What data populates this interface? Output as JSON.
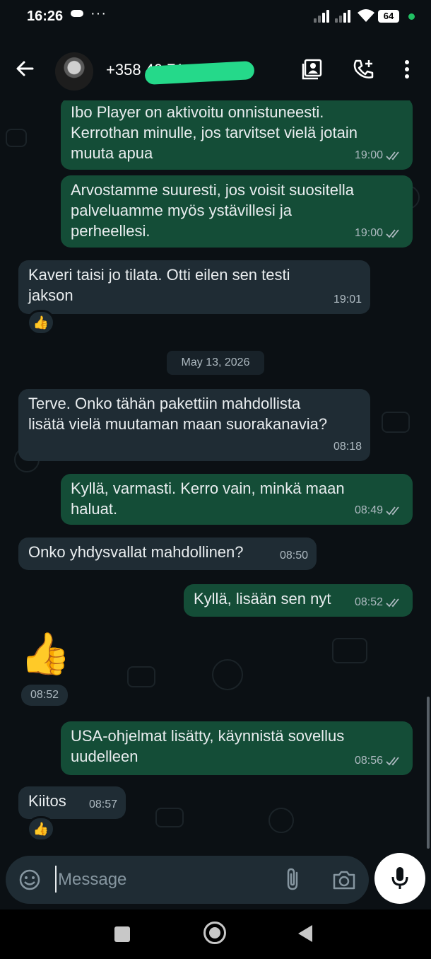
{
  "status_bar": {
    "time": "16:26",
    "more": "···",
    "battery": "64"
  },
  "header": {
    "contact_phone": "+358 40 71"
  },
  "messages": [
    {
      "dir": "out",
      "text": "Ibo Player on aktivoitu onnistuneesti.\nKerrothan minulle, jos tarvitset vielä jotain\nmuuta apua",
      "time": "19:00"
    },
    {
      "dir": "out",
      "text": "Arvostamme suuresti, jos voisit suositella\npalveluamme myös ystävillesi ja\nperheellesi.",
      "time": "19:00"
    },
    {
      "dir": "in",
      "text": "Kaveri taisi jo tilata. Otti eilen sen testi\njakson",
      "time": "19:01",
      "reaction": "👍"
    },
    {
      "dir": "in",
      "text": "Terve. Onko tähän pakettiin mahdollista\nlisätä vielä muutaman maan suorakanavia?",
      "time": "08:18"
    },
    {
      "dir": "out",
      "text": "Kyllä, varmasti. Kerro vain, minkä maan\nhaluat.",
      "time": "08:49"
    },
    {
      "dir": "in",
      "text": "Onko yhdysvallat mahdollinen?",
      "time": "08:50"
    },
    {
      "dir": "out",
      "text": "Kyllä, lisään sen nyt",
      "time": "08:52"
    },
    {
      "dir": "in",
      "sticker": "👍",
      "time": "08:52"
    },
    {
      "dir": "out",
      "text": "USA-ohjelmat lisätty, käynnistä sovellus\nuudelleen",
      "time": "08:56"
    },
    {
      "dir": "in",
      "text": "Kiitos",
      "time": "08:57",
      "reaction": "👍"
    }
  ],
  "date_separator": "May 13, 2026",
  "composer": {
    "placeholder": "Message"
  },
  "colors": {
    "outgoing_bubble": "#144d37",
    "incoming_bubble": "#1f2c34",
    "background": "#0b1014",
    "accent": "#25d98a"
  },
  "icons": [
    "back-arrow-icon",
    "contact-card-icon",
    "add-call-icon",
    "more-vert-icon",
    "emoji-icon",
    "attach-icon",
    "camera-icon",
    "mic-icon",
    "double-tick-icon"
  ]
}
